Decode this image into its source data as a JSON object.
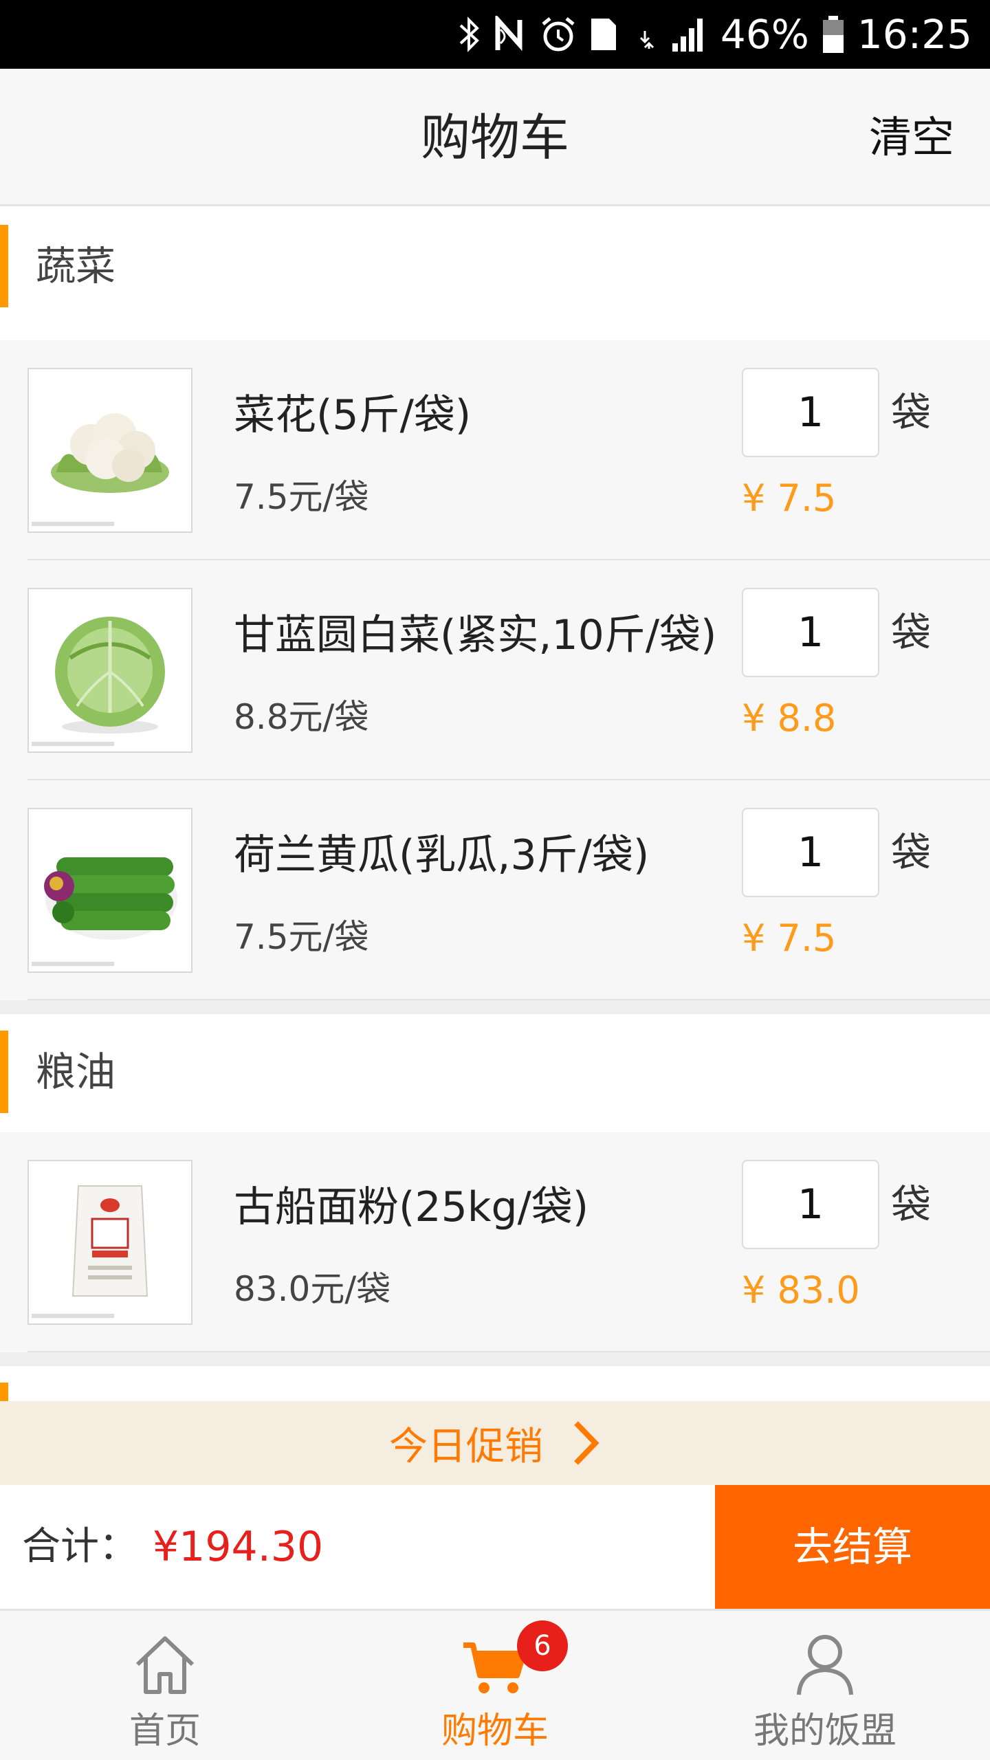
{
  "status_bar": {
    "battery_percent": "46%",
    "time": "16:25",
    "icons": [
      "bluetooth-icon",
      "nfc-icon",
      "alarm-icon",
      "sim-1-icon",
      "4g-icon",
      "signal-icon",
      "battery-icon"
    ],
    "sim_label": "1",
    "network_label": "4G"
  },
  "header": {
    "title": "购物车",
    "clear_label": "清空"
  },
  "categories": [
    {
      "name": "蔬菜",
      "items": [
        {
          "name": "菜花(5斤/袋)",
          "unit_price": "7.5元/袋",
          "quantity": "1",
          "unit": "袋",
          "line_total": "¥ 7.5",
          "image": "cauliflower"
        },
        {
          "name": "甘蓝圆白菜(紧实,10斤/袋)",
          "unit_price": "8.8元/袋",
          "quantity": "1",
          "unit": "袋",
          "line_total": "¥ 8.8",
          "image": "cabbage"
        },
        {
          "name": "荷兰黄瓜(乳瓜,3斤/袋)",
          "unit_price": "7.5元/袋",
          "quantity": "1",
          "unit": "袋",
          "line_total": "¥ 7.5",
          "image": "cucumber"
        }
      ]
    },
    {
      "name": "粮油",
      "items": [
        {
          "name": "古船面粉(25kg/袋)",
          "unit_price": "83.0元/袋",
          "quantity": "1",
          "unit": "袋",
          "line_total": "¥ 83.0",
          "image": "flour-bag"
        }
      ]
    }
  ],
  "promo": {
    "label": "今日促销",
    "icon": "chevron-right-icon"
  },
  "summary": {
    "total_label": "合计：",
    "total_amount": "¥194.30",
    "checkout_label": "去结算"
  },
  "tab_bar": {
    "tabs": [
      {
        "label": "首页",
        "icon": "home-icon",
        "active": false
      },
      {
        "label": "购物车",
        "icon": "cart-icon",
        "active": true,
        "badge": "6"
      },
      {
        "label": "我的饭盟",
        "icon": "user-icon",
        "active": false
      }
    ]
  },
  "colors": {
    "accent_orange": "#ff9900",
    "checkout_orange": "#ff6600",
    "price_red": "#e8201b",
    "promo_background": "#f4ede0"
  }
}
